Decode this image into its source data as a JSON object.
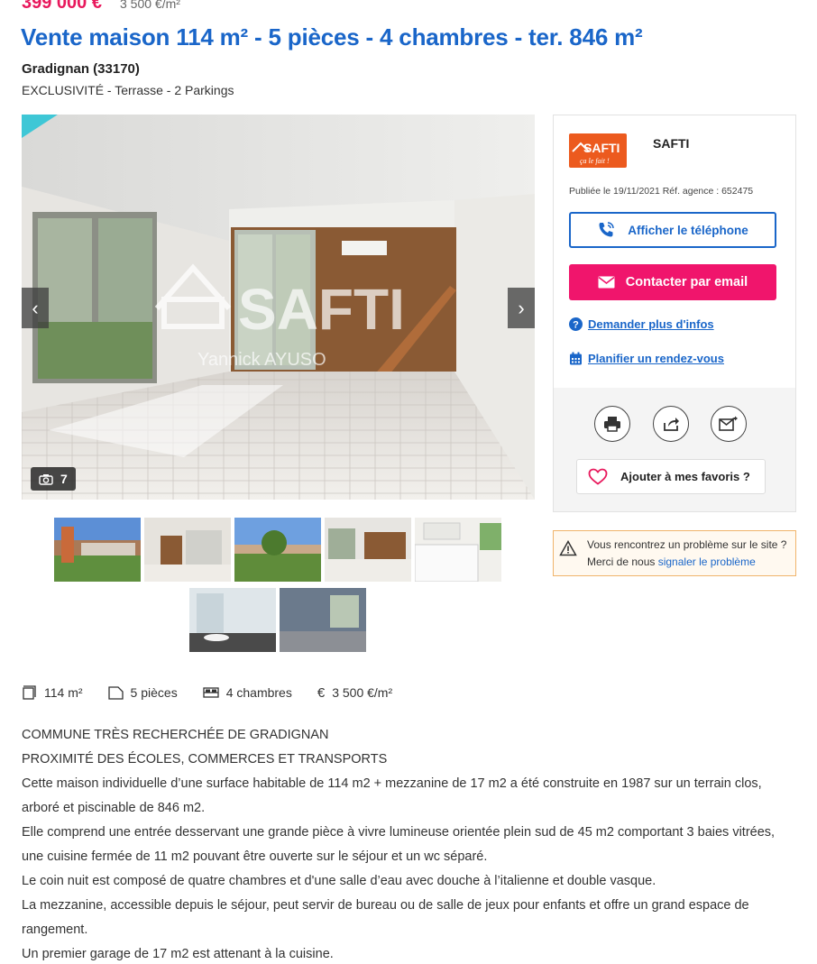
{
  "listing": {
    "price": "399 000 €",
    "price_per_m2": "3 500 €/m²",
    "title": "Vente maison 114 m² - 5 pièces - 4 chambres - ter. 846 m²",
    "city": "Gradignan (33170)",
    "subtitle": "EXCLUSIVITÉ - Terrasse - 2 Parkings"
  },
  "gallery": {
    "photo_count": "7",
    "watermark_brand": "SAFTI",
    "watermark_agent": "Yannick AYUSO",
    "prev_icon": "chevron-left-icon",
    "next_icon": "chevron-right-icon"
  },
  "features": [
    {
      "icon": "surface-icon",
      "label": "114 m²"
    },
    {
      "icon": "rooms-icon",
      "label": "5 pièces"
    },
    {
      "icon": "bed-icon",
      "label": "4 chambres"
    },
    {
      "icon": "euro-icon",
      "label": "3 500 €/m²"
    }
  ],
  "description": [
    "COMMUNE TRÈS RECHERCHÉE DE GRADIGNAN",
    "PROXIMITÉ DES ÉCOLES, COMMERCES ET TRANSPORTS",
    "Cette maison individuelle d’une surface habitable de 114 m2 + mezzanine de 17 m2 a été construite en 1987 sur un terrain clos, arboré et piscinable de 846 m2.",
    "Elle comprend une entrée desservant une grande pièce à vivre lumineuse orientée plein sud de 45 m2 comportant 3 baies vitrées, une cuisine fermée de 11 m2 pouvant être ouverte sur le séjour et un wc séparé.",
    "Le coin nuit est composé de quatre chambres et d'une salle d’eau avec douche à l’italienne et double vasque.",
    "La mezzanine, accessible depuis le séjour, peut servir de bureau ou de salle de jeux pour enfants et offre un grand espace de rangement.",
    "Un premier garage de 17 m2 est attenant à la cuisine."
  ],
  "agency": {
    "logo_text": "SAFTI",
    "logo_tagline": "ça le fait !",
    "name": "SAFTI",
    "published": "Publiée le 19/11/2021 Réf. agence : 652475",
    "phone_button": "Afficher le téléphone",
    "email_button": "Contacter par email",
    "more_info_link": "Demander plus d'infos",
    "appointment_link": "Planifier un rendez-vous",
    "favorite_button": "Ajouter à mes favoris ?"
  },
  "report": {
    "line1": "Vous rencontrez un problème sur le site ?",
    "line2_prefix": "Merci de nous",
    "line2_link": "signaler le problème"
  },
  "colors": {
    "price": "#e8185c",
    "title": "#1a66c9",
    "email_button": "#f0156c",
    "logo": "#ec5a1e",
    "report_border": "#f0b46c"
  }
}
